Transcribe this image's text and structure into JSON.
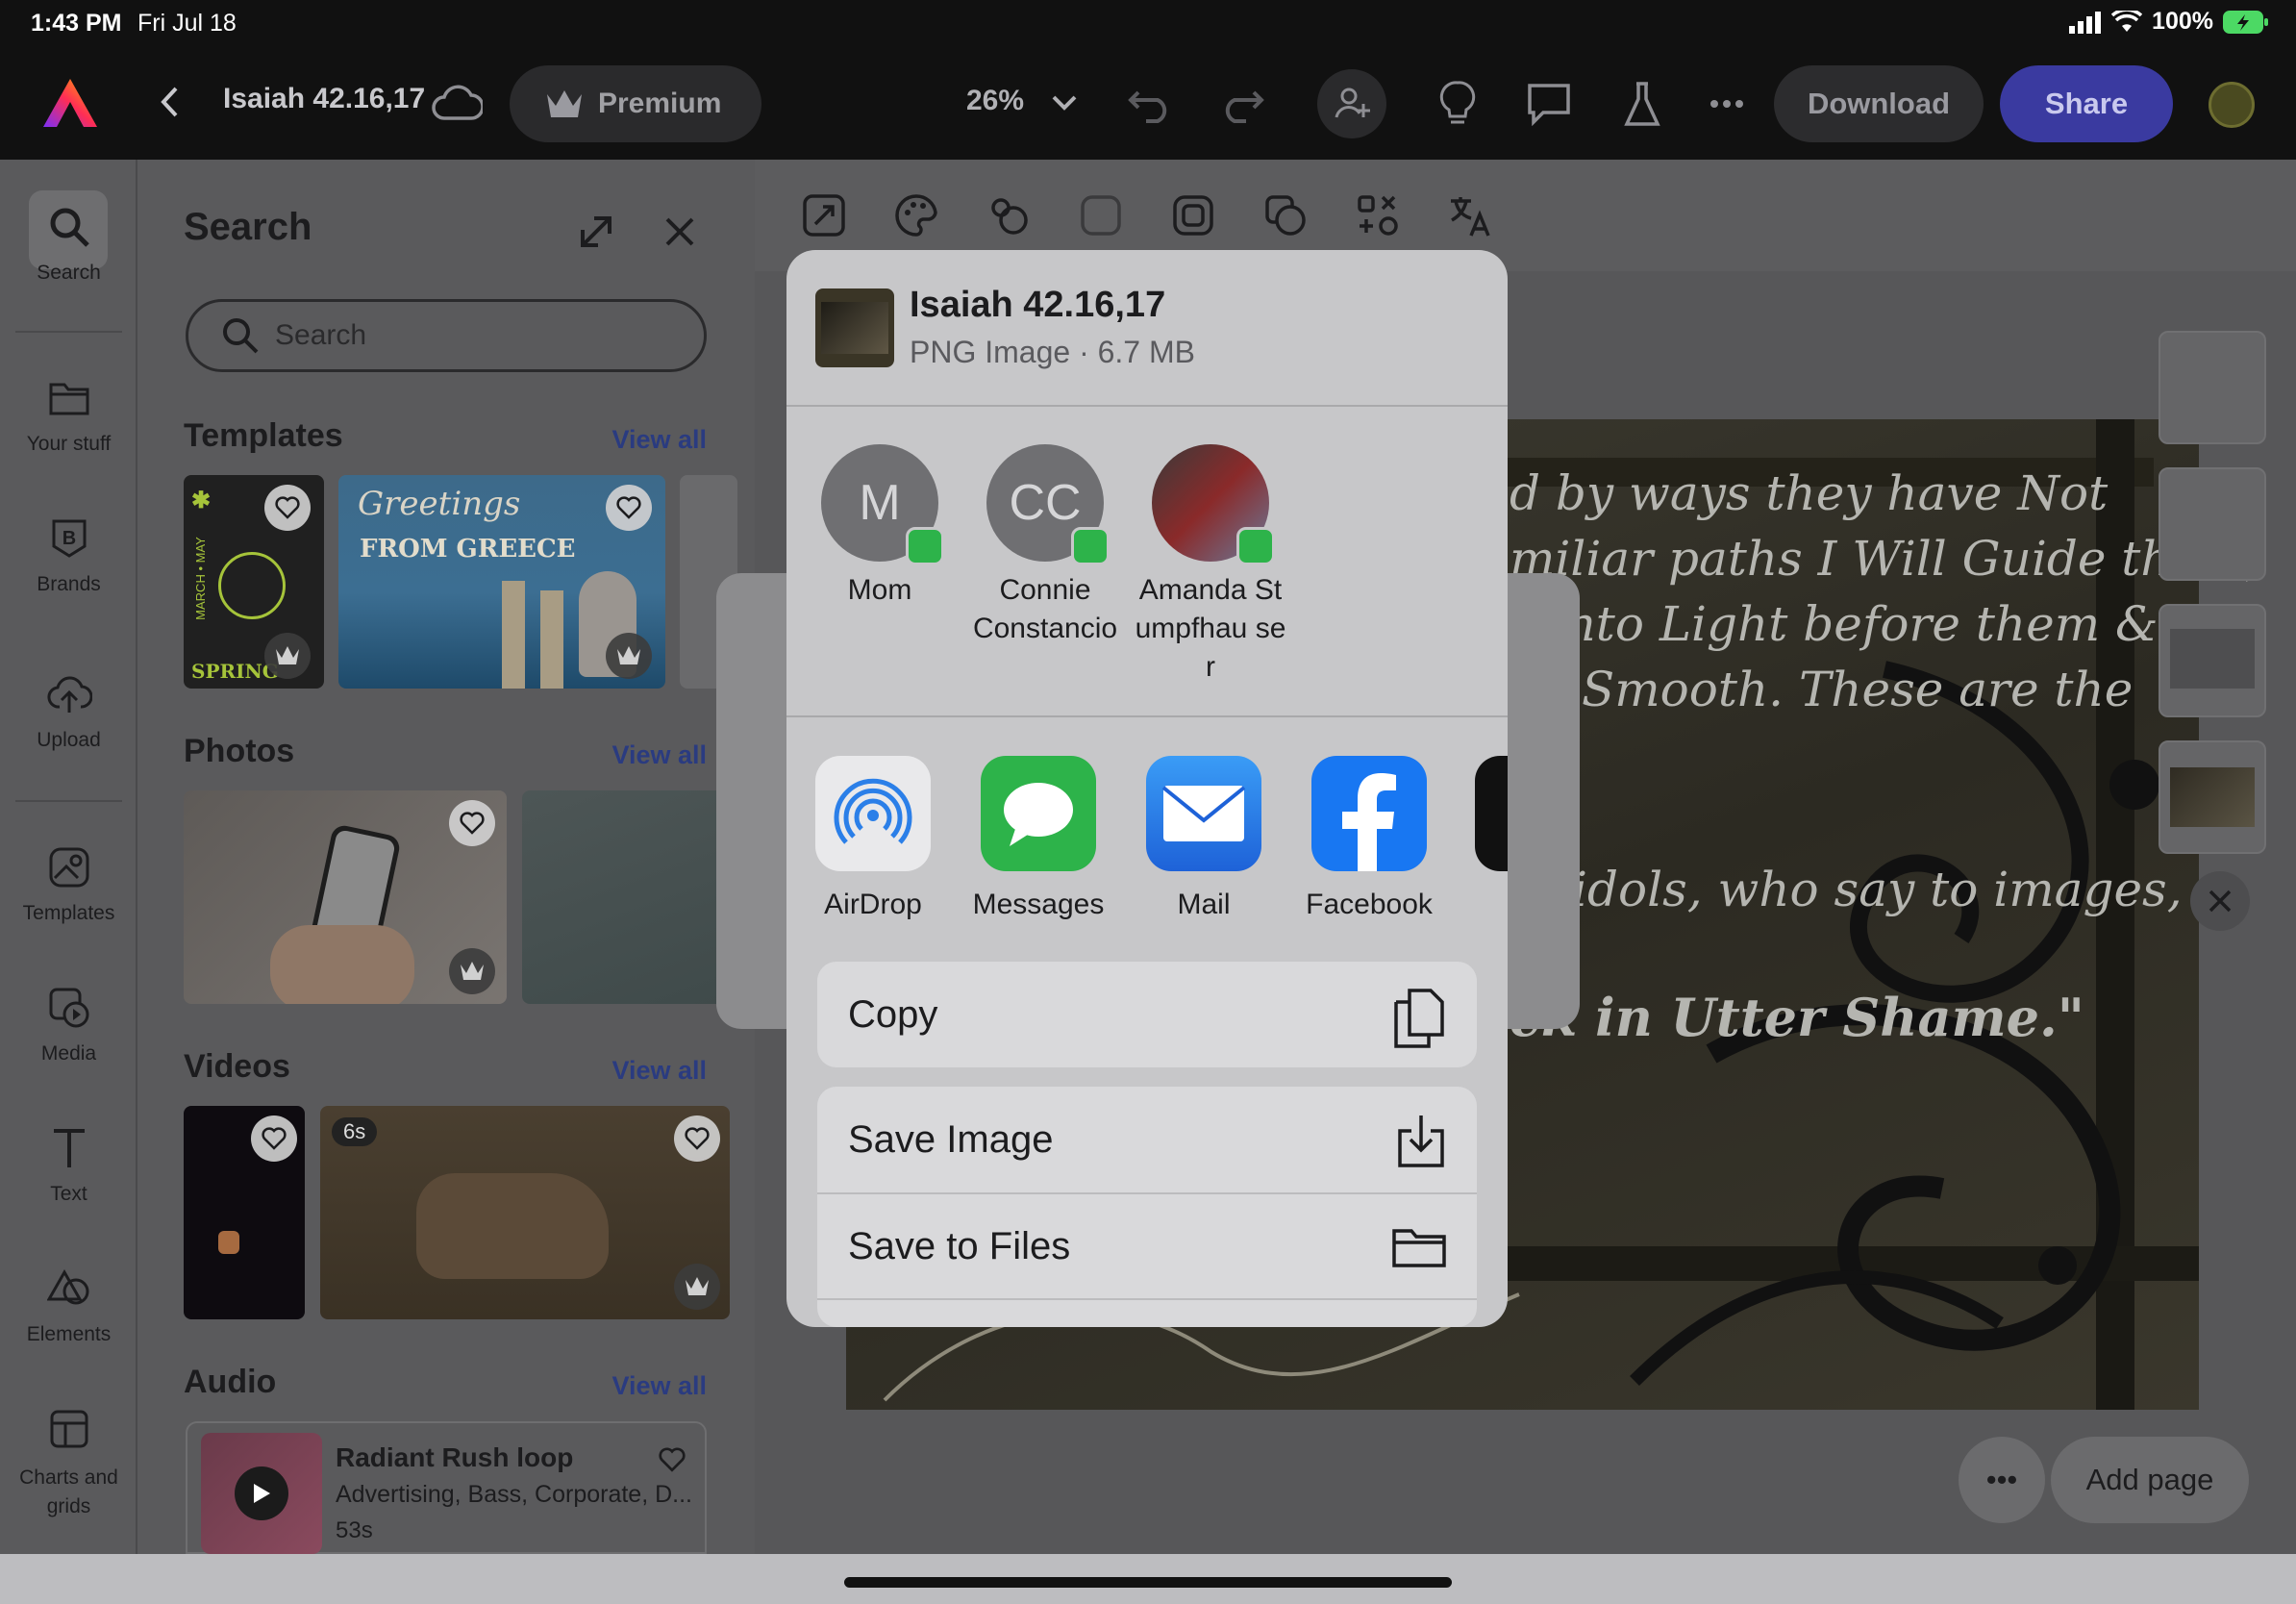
{
  "status_bar": {
    "time": "1:43 PM",
    "date": "Fri Jul 18",
    "battery": "100%"
  },
  "toolbar": {
    "doc_title": "Isaiah 42.16,17",
    "premium_label": "Premium",
    "zoom": "26%",
    "download_label": "Download",
    "share_label": "Share"
  },
  "rail": {
    "items": [
      {
        "label": "Search"
      },
      {
        "label": "Your stuff"
      },
      {
        "label": "Brands"
      },
      {
        "label": "Upload"
      },
      {
        "label": "Templates"
      },
      {
        "label": "Media"
      },
      {
        "label": "Text"
      },
      {
        "label": "Elements"
      },
      {
        "label": "Charts and grids"
      }
    ]
  },
  "panel": {
    "title": "Search",
    "search_placeholder": "Search",
    "sections": {
      "templates": {
        "title": "Templates",
        "view_all": "View all"
      },
      "photos": {
        "title": "Photos",
        "view_all": "View all"
      },
      "videos": {
        "title": "Videos",
        "view_all": "View all"
      },
      "audio": {
        "title": "Audio",
        "view_all": "View all"
      }
    },
    "template_cards": [
      {
        "text_1": "MARCH • MAY",
        "text_2": "SPRING"
      },
      {
        "text_1": "Greetings",
        "text_2": "FROM GREECE"
      }
    ],
    "video_badge": "6s",
    "audio_item": {
      "title": "Radiant Rush loop",
      "tags": "Advertising, Bass, Corporate, D...",
      "duration": "53s"
    }
  },
  "canvas": {
    "art_lines": [
      "d by ways they have Not",
      "miliar paths I Will Guide them;",
      "s into Light before them &",
      "Smooth. These are the",
      ".",
      "idols, who say to images,",
      "ck in Utter Shame.\""
    ],
    "more_label": "•••",
    "add_page_label": "Add page"
  },
  "share_sheet": {
    "file_name": "Isaiah 42.16,17",
    "file_info": "PNG Image · 6.7 MB",
    "contacts": [
      {
        "initials": "M",
        "name": "Mom"
      },
      {
        "initials": "CC",
        "name": "Connie Constancio"
      },
      {
        "initials": "",
        "name": "Amanda Stumpfhau ser"
      }
    ],
    "apps": [
      {
        "name": "AirDrop",
        "icon": "airdrop-icon",
        "color": "#e9e9eb"
      },
      {
        "name": "Messages",
        "icon": "messages-icon",
        "color": "#2db34a"
      },
      {
        "name": "Mail",
        "icon": "mail-icon",
        "color": "#2b7fe8"
      },
      {
        "name": "Facebook",
        "icon": "facebook-icon",
        "color": "#1877f2"
      }
    ],
    "actions": [
      {
        "label": "Copy",
        "icon": "copy-icon"
      },
      {
        "label": "Save Image",
        "icon": "save-image-icon"
      },
      {
        "label": "Save to Files",
        "icon": "folder-icon"
      }
    ]
  }
}
